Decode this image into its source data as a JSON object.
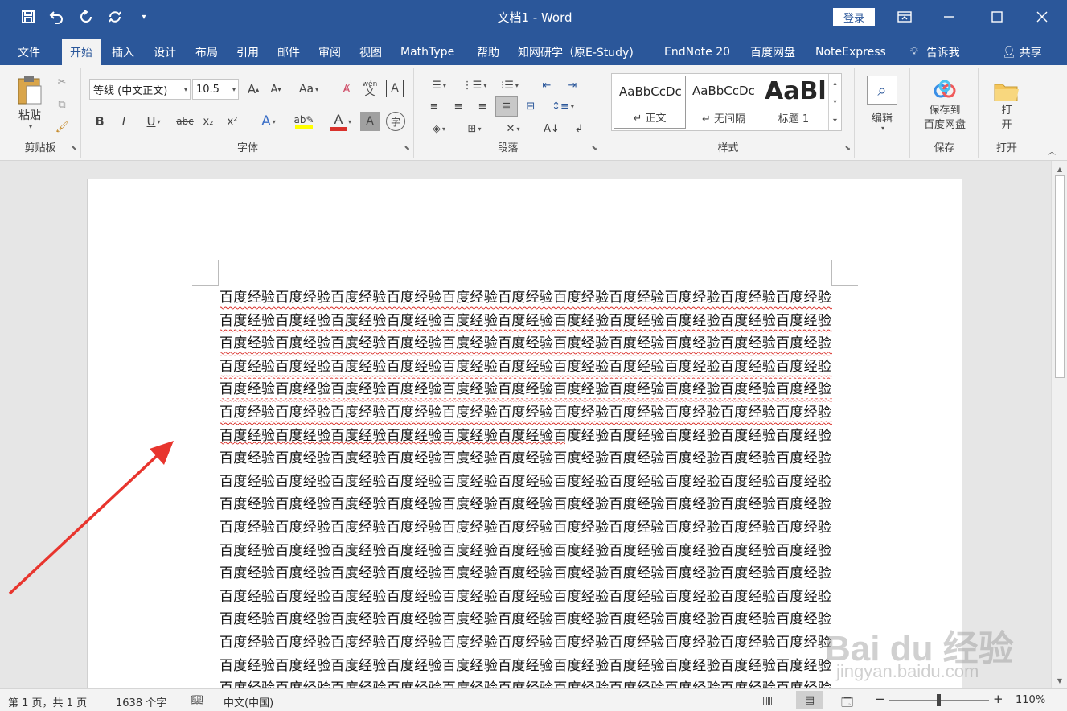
{
  "titlebar": {
    "title": "文档1  -  Word",
    "login_label": "登录"
  },
  "tabs": [
    {
      "label": "文件"
    },
    {
      "label": "开始"
    },
    {
      "label": "插入"
    },
    {
      "label": "设计"
    },
    {
      "label": "布局"
    },
    {
      "label": "引用"
    },
    {
      "label": "邮件"
    },
    {
      "label": "审阅"
    },
    {
      "label": "视图"
    },
    {
      "label": "MathType"
    },
    {
      "label": "帮助"
    },
    {
      "label": "知网研学（原E-Study)"
    },
    {
      "label": "EndNote 20"
    },
    {
      "label": "百度网盘"
    },
    {
      "label": "NoteExpress"
    },
    {
      "label": "告诉我"
    },
    {
      "label": "共享"
    }
  ],
  "ribbon": {
    "clipboard": {
      "paste": "粘贴",
      "label": "剪贴板"
    },
    "font": {
      "font_name": "等线 (中文正文)",
      "font_size": "10.5",
      "label": "字体",
      "wen_glyph": "wén",
      "wen_char": "文",
      "case_label": "Aa",
      "bold": "B",
      "italic": "I",
      "underline": "U",
      "strike": "abc",
      "sub": "x₂",
      "sup": "x²",
      "fx": "A",
      "color_a": "A",
      "shade_a": "A",
      "box_a": "A"
    },
    "paragraph": {
      "label": "段落"
    },
    "styles": {
      "label": "样式",
      "items": [
        {
          "preview": "AaBbCcDc",
          "name": "↵ 正文"
        },
        {
          "preview": "AaBbCcDc",
          "name": "↵ 无间隔"
        },
        {
          "preview": "AaBl",
          "name": "标题 1"
        }
      ]
    },
    "edit": {
      "label": "编辑"
    },
    "save": {
      "button": "保存到\n百度网盘",
      "label": "保存"
    },
    "open": {
      "button": "打\n开",
      "label": "打开"
    }
  },
  "document": {
    "text": "百度经验百度经验百度经验百度经验百度经验百度经验百度经验百度经验百度经验百度经验百度经验百度经验百度经验百度经验百度经验百度经验百度经验百度经验百度经验百度经验百度经验百度经验百度经验百度经验百度经验百度经验百度经验百度经验百度经验百度经验百度经验百度经验百度经验百度经验百度经验百度经验百度经验百度经验百度经验百度经验百度经验百度经验百度经验百度经验百度经验百度经验百度经验百度经验百度经验百度经验百度经验百度经验百度经验百度经验百度经验百度经验百度经验百度经验百度经验百度经验百度经验百度经验百度经验百度经验百度经验百度经验百度经验百度经验百度经验百度经验百度经验百度经验百度经验百度经验百度经验百度经验百度经验百度经验百度经验百度经验百度经验百度经验百度经验百度经验百度经验百度经验百度经验百度经验百度经验百度经验百度经验百度经验百度经验百度经验百度经验百度经验百度经验百度经验百度经验百度经验百度经验百度经验百度经验百度经验百度经验百度经验百度经验百度经验百度经验百度经验百度经验百度经验百度经验百度经验百度经验百度经验百度经验百度经验百度经验百度经验百度经验百度经验百度经验百度经验百度经验百度经验百度经验百度经验百度经验百度经验百度经验百度经验百度经验百度经验百度经验百度经验百度经验百度经验百度经验百度经验百度经验百度经验百度经验百度经验百度经验百度经验百度经验百度经验百度经验百度经验百度经验百度经验百度经验百度经验百度经验百度经验百度经验百度经验百度经验百度经验百度经验百度经验百度经验百度经验百度经验百度经验百度经验百度经验百度经验百度经验百度经验百度经验百度经验百度经验百度经验百度经验百度经验百度经验百度经验百度经验百度经验百度经验百度经验百度经验百度经验百度经验百度经验百度经验百度经验百度经验百度经验百度经验百度经验百度经验百度经验百度经验百度经验百度经验百度经验百度经验百度经验百度经验百度经验百度经验百度经验百度经验百度经验百度经验百度经验百度经验百度经验百度经验百度经验百度经验百度经验百度经验百度经验百度经验"
  },
  "statusbar": {
    "page": "第 1 页，共 1 页",
    "words": "1638 个字",
    "language": "中文(中国)",
    "zoom_minus": "−",
    "zoom_plus": "+",
    "zoom": "110%"
  },
  "watermark": {
    "main": "Bai du 经验",
    "sub": "jingyan.baidu.com"
  },
  "colors": {
    "accent": "#2b579a",
    "arrow": "#e8352e",
    "spell_underline": "#d9312b"
  }
}
